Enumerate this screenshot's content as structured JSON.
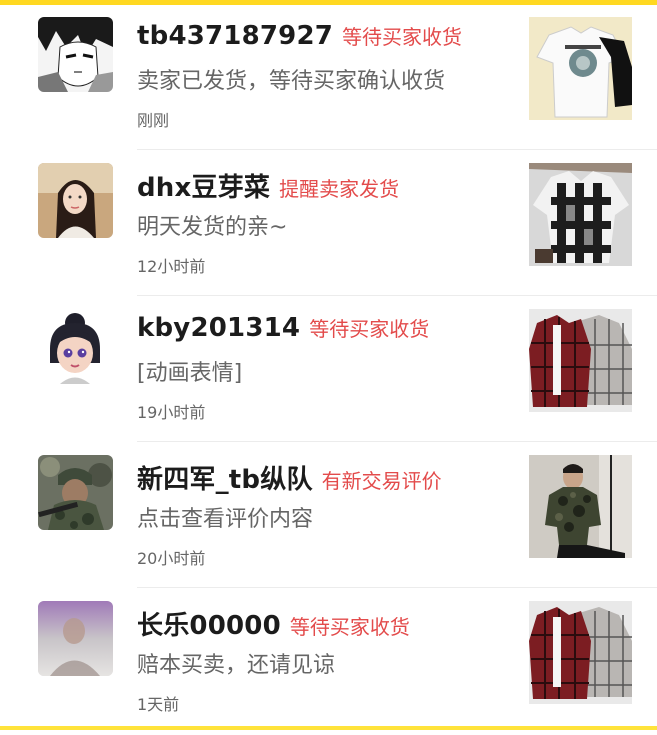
{
  "conversations": [
    {
      "name": "tb437187927",
      "status": "等待买家收货",
      "message": "卖家已发货，等待买家确认收货",
      "time": "刚刚",
      "avatar_icon": "anime-boy-avatar",
      "thumb_icon": "white-tshirt-thumbnail"
    },
    {
      "name": "dhx豆芽菜",
      "status": "提醒卖家发货",
      "message": "明天发货的亲~",
      "time": "12小时前",
      "avatar_icon": "girl-photo-avatar",
      "thumb_icon": "plaid-shirt-thumbnail"
    },
    {
      "name": "kby201314",
      "status": "等待买家收货",
      "message": "[动画表情]",
      "time": "19小时前",
      "avatar_icon": "cartoon-girl-avatar",
      "thumb_icon": "red-plaid-shirts-thumbnail"
    },
    {
      "name": "新四军_tb纵队",
      "status": "有新交易评价",
      "message": "点击查看评价内容",
      "time": "20小时前",
      "avatar_icon": "soldier-photo-avatar",
      "thumb_icon": "camo-tshirt-model-thumbnail"
    },
    {
      "name": "长乐00000",
      "status": "等待买家收货",
      "message": "赔本买卖，还请见谅",
      "time": "1天前",
      "avatar_icon": "hazy-portrait-avatar",
      "thumb_icon": "red-plaid-shirts-thumbnail"
    }
  ],
  "colors": {
    "top_accent": "#ffd821",
    "status_red": "#e34b4b",
    "name": "#1c1c1c",
    "secondary": "#666666"
  }
}
